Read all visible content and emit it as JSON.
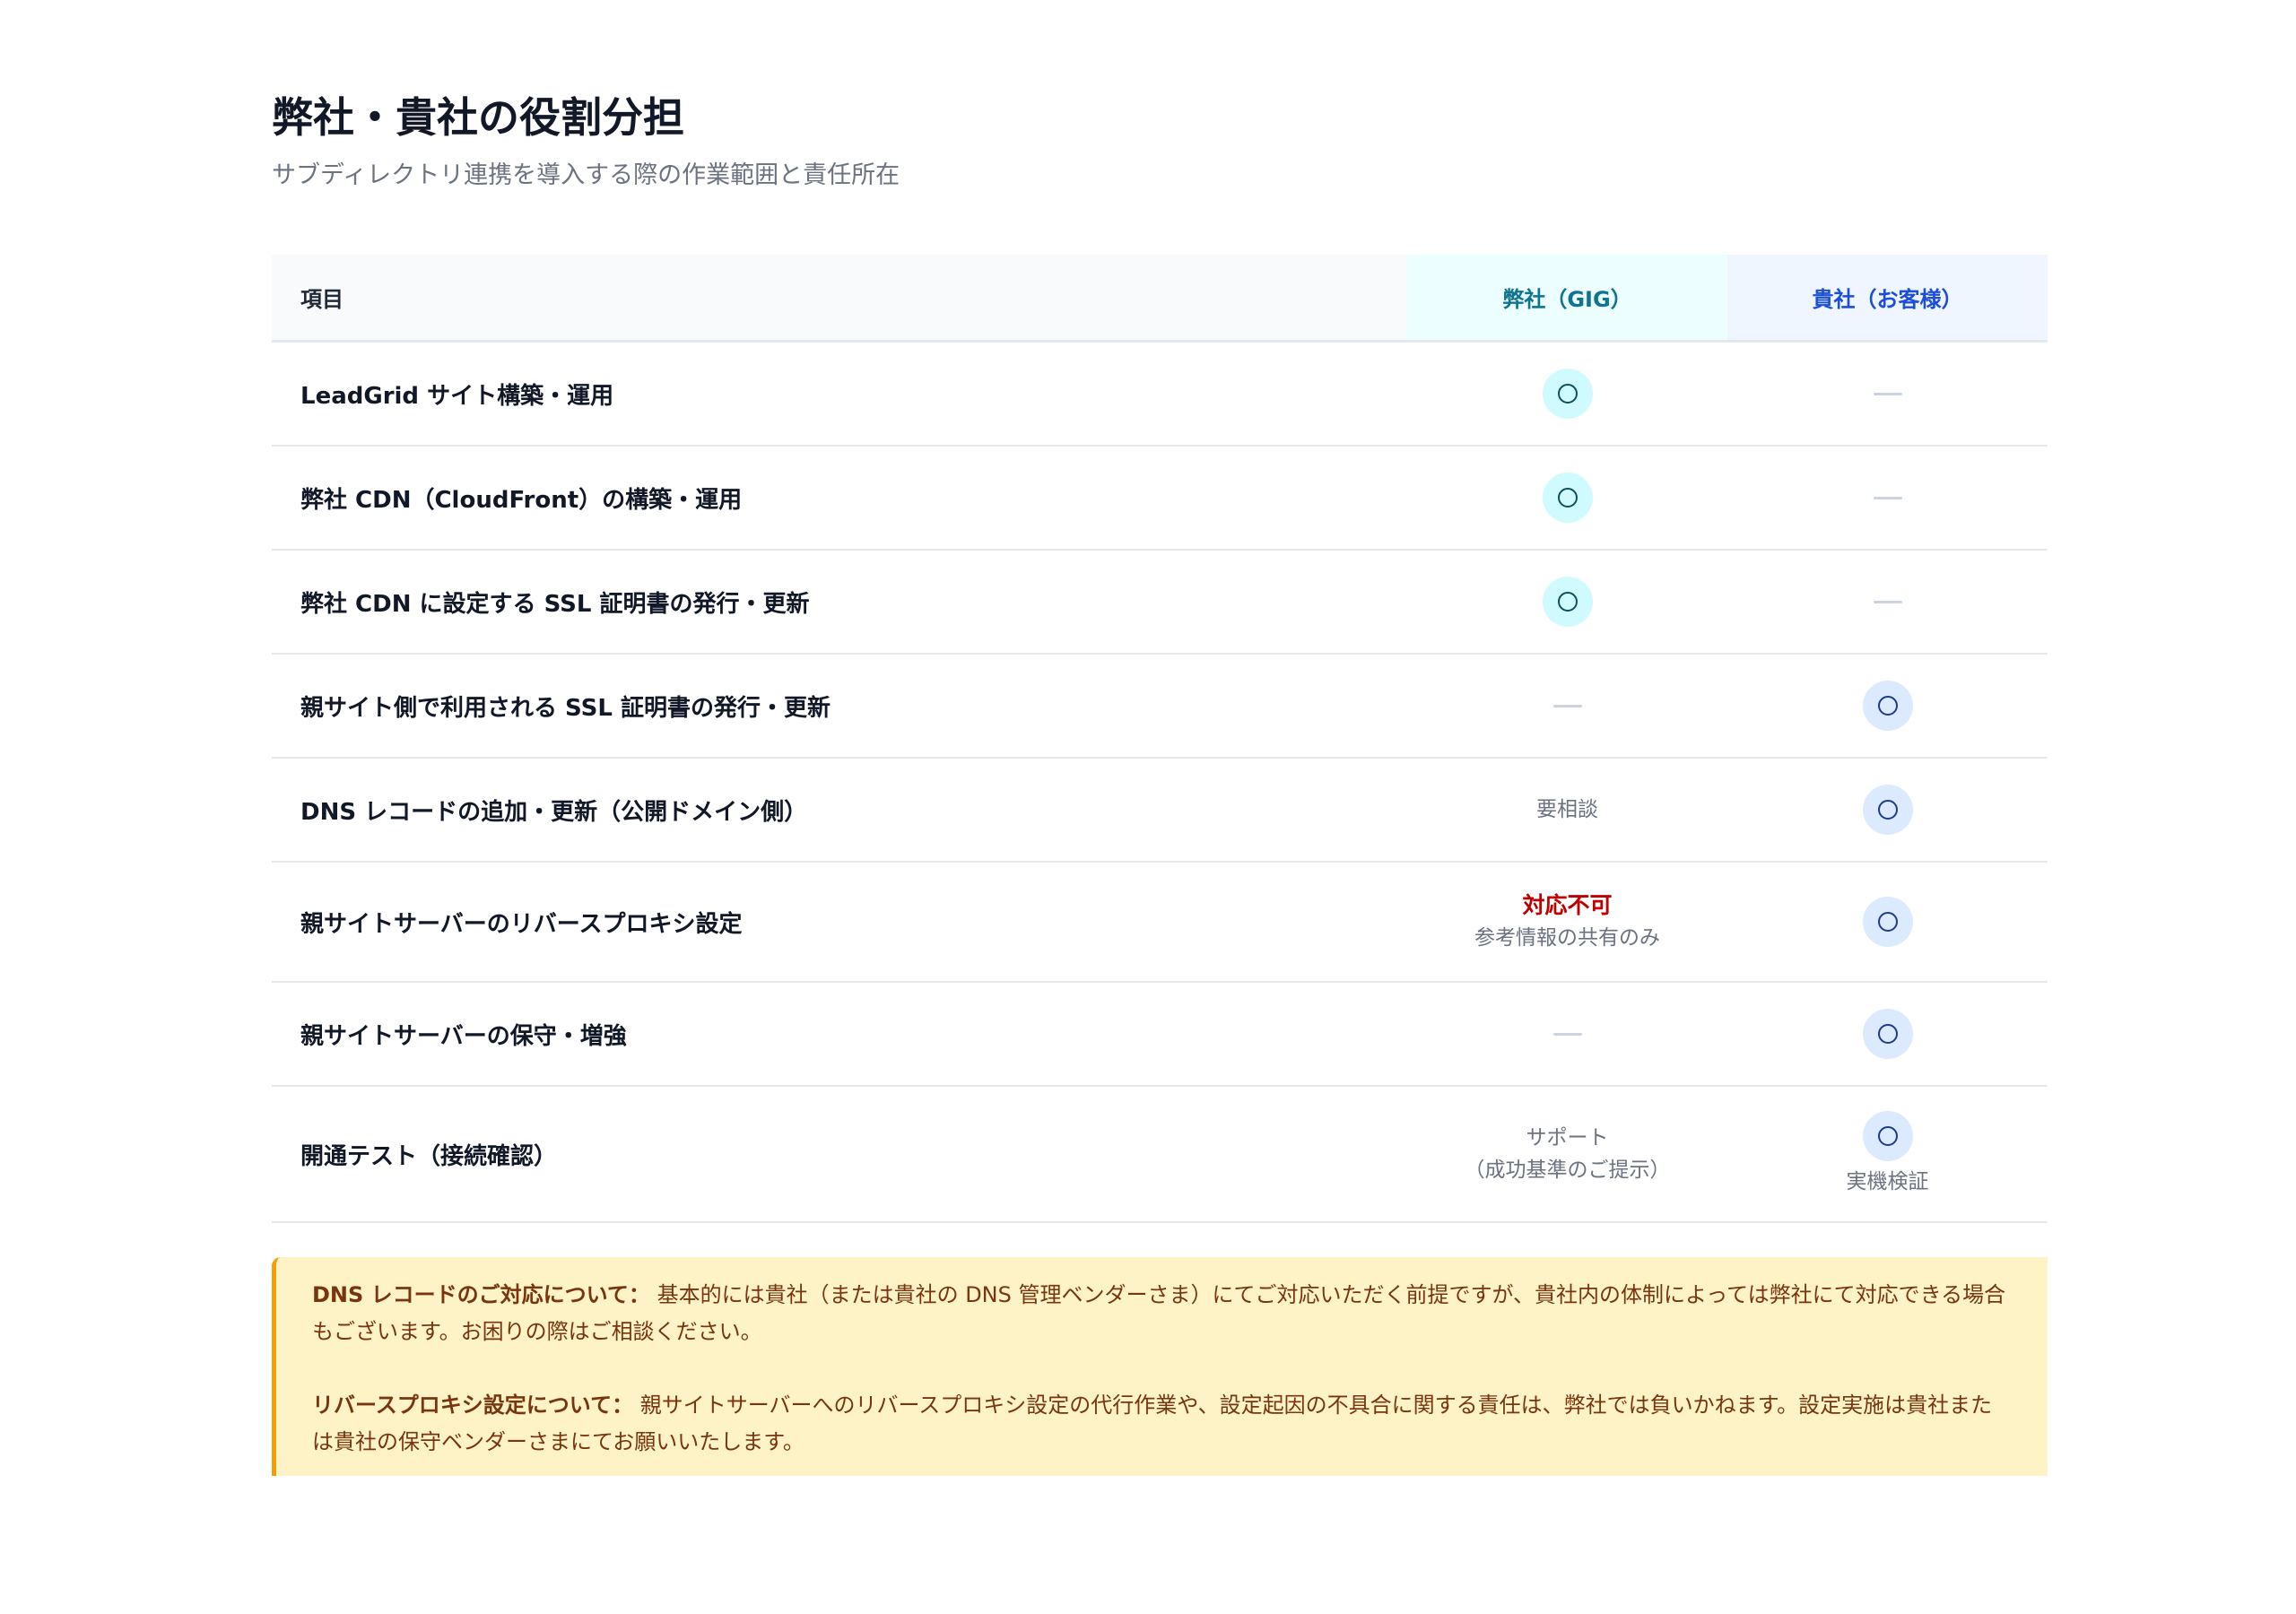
{
  "header": {
    "title": "弊社・貴社の役割分担",
    "subtitle": "サブディレクトリ連携を導入する際の作業範囲と責任所在"
  },
  "table": {
    "columns": {
      "item": "項目",
      "gig": "弊社（GIG）",
      "customer": "貴社（お客様）"
    },
    "rows": [
      {
        "item": "LeadGrid サイト構築・運用",
        "gig": {
          "type": "circle"
        },
        "customer": {
          "type": "dash"
        }
      },
      {
        "item": "弊社 CDN（CloudFront）の構築・運用",
        "gig": {
          "type": "circle"
        },
        "customer": {
          "type": "dash"
        }
      },
      {
        "item": "弊社 CDN に設定する SSL 証明書の発行・更新",
        "gig": {
          "type": "circle"
        },
        "customer": {
          "type": "dash"
        }
      },
      {
        "item": "親サイト側で利用される SSL 証明書の発行・更新",
        "gig": {
          "type": "dash"
        },
        "customer": {
          "type": "circle"
        }
      },
      {
        "item": "DNS レコードの追加・更新（公開ドメイン側）",
        "gig": {
          "type": "text",
          "text": "要相談"
        },
        "customer": {
          "type": "circle"
        }
      },
      {
        "item": "親サイトサーバーのリバースプロキシ設定",
        "gig": {
          "type": "danger",
          "text": "対応不可",
          "note": "参考情報の共有のみ"
        },
        "customer": {
          "type": "circle"
        }
      },
      {
        "item": "親サイトサーバーの保守・増強",
        "gig": {
          "type": "dash"
        },
        "customer": {
          "type": "circle"
        }
      },
      {
        "item": "開通テスト（接続確認）",
        "gig": {
          "type": "text2",
          "text": "サポート",
          "note": "（成功基準のご提示）"
        },
        "customer": {
          "type": "circle-note",
          "note": "実機検証"
        }
      }
    ]
  },
  "notice": {
    "dns_label": "DNS レコードのご対応について：",
    "dns_text": "基本的には貴社（または貴社の DNS 管理ベンダーさま）にてご対応いただく前提ですが、貴社内の体制によっては弊社にて対応できる場合もございます。お困りの際はご相談ください。",
    "proxy_label": "リバースプロキシ設定について：",
    "proxy_text": "親サイトサーバーへのリバースプロキシ設定の代行作業や、設定起因の不具合に関する責任は、弊社では負いかねます。設定実施は貴社または貴社の保守ベンダーさまにてお願いいたします。"
  },
  "colors": {
    "gig_accent": "#0e7490",
    "customer_accent": "#1d4ed8",
    "danger": "#c00000",
    "notice_bg": "#fef3c7",
    "notice_border": "#f59e0b"
  }
}
